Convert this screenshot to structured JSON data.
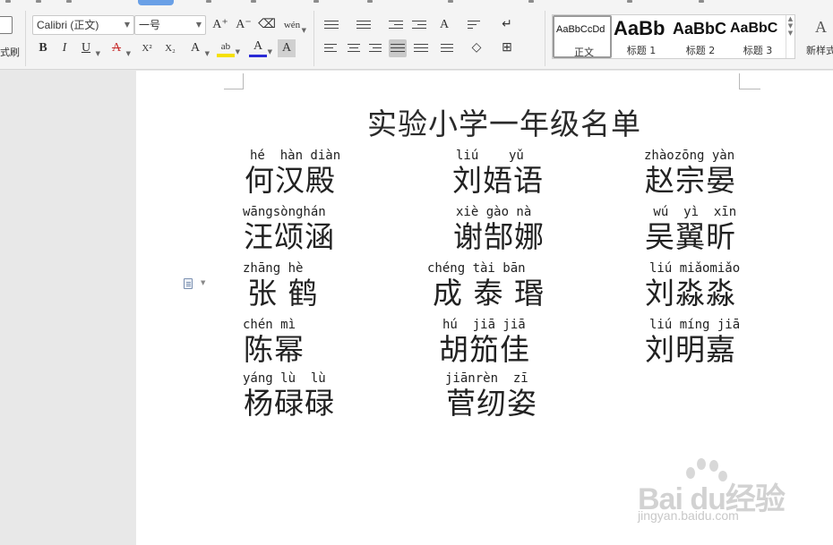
{
  "toolbar": {
    "format_painter_label": "式刷",
    "font_name": "Calibri (正文)",
    "font_size": "一号",
    "font_buttons": {
      "grow": "A⁺",
      "shrink": "A⁻",
      "clear": "⌫",
      "phonetic": "wén",
      "bold": "B",
      "italic": "I",
      "underline": "U",
      "strike": "A",
      "superscript": "X²",
      "subscript": "X₂",
      "text_effect": "A",
      "highlight": "ab",
      "font_color": "A",
      "char_shading": "A"
    },
    "icons": {
      "bullets": "bullets-icon",
      "numbering": "numbering-icon",
      "decrease_indent": "decrease-indent-icon",
      "increase_indent": "increase-indent-icon",
      "chinese_layout": "chinese-layout-icon",
      "sort": "sort-icon",
      "show_marks": "show-marks-icon",
      "align_left": "align-left-icon",
      "align_center": "align-center-icon",
      "align_right": "align-right-icon",
      "justify": "justify-icon",
      "distributed": "distributed-icon",
      "line_spacing": "line-spacing-icon",
      "shading": "shading-icon",
      "borders": "borders-icon"
    },
    "styles": [
      {
        "sample": "AaBbCcDd",
        "name": "正文",
        "active": true
      },
      {
        "sample": "AaBb",
        "name": "标题 1",
        "active": false
      },
      {
        "sample": "AaBbC",
        "name": "标题 2",
        "active": false
      },
      {
        "sample": "AaBbC",
        "name": "标题 3",
        "active": false
      }
    ],
    "new_style_label": "新样式",
    "new_style_icon": "A",
    "accent_color": "#6aa0e6",
    "font_color_bar": "#2b2bd6",
    "highlight_bar": "#f5e000",
    "strike_color": "#c83232"
  },
  "document": {
    "title": "实验小学一年级名单",
    "entries": [
      {
        "pinyin": "hé  hàn diàn",
        "hanzi": "何汉殿"
      },
      {
        "pinyin": "liú    yǔ",
        "hanzi": "刘娪语"
      },
      {
        "pinyin": "zhàozōng yàn",
        "hanzi": "赵宗晏"
      },
      {
        "pinyin": "wāngsònghán",
        "hanzi": "汪颂涵"
      },
      {
        "pinyin": "xiè gào nà",
        "hanzi": "谢郜娜"
      },
      {
        "pinyin": " wú  yì  xīn",
        "hanzi": "吴翼昕"
      },
      {
        "pinyin": "zhāng hè",
        "hanzi": "张 鹤"
      },
      {
        "pinyin": "chéng tài bān",
        "hanzi": "成 泰 瑉"
      },
      {
        "pinyin": "liú miǎomiǎo",
        "hanzi": "刘淼淼"
      },
      {
        "pinyin": "chén mì",
        "hanzi": "陈幂"
      },
      {
        "pinyin": "hú  jiā jiā",
        "hanzi": "胡笳佳"
      },
      {
        "pinyin": "liú míng jiā",
        "hanzi": "刘明嘉"
      },
      {
        "pinyin": "yáng lù  lù",
        "hanzi": "杨碌碌"
      },
      {
        "pinyin": "jiānrèn  zī",
        "hanzi": "菅纫姿"
      }
    ]
  },
  "watermark": {
    "brand": "Bai du经验",
    "url": "jingyan.baidu.com"
  }
}
